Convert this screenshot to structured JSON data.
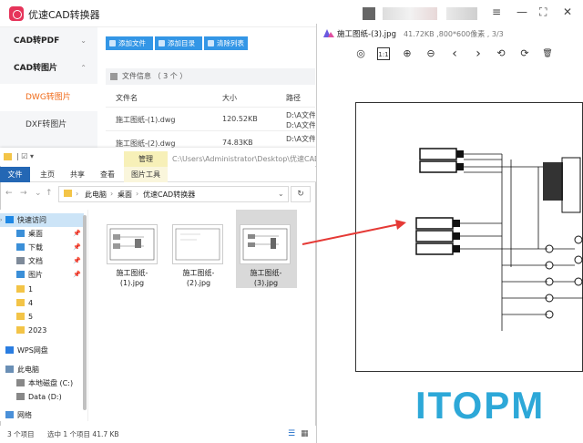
{
  "cad_app": {
    "title": "优速CAD转换器",
    "window_controls": [
      "≡",
      "—",
      "⛶",
      "✕"
    ],
    "sidebar": [
      {
        "label": "CAD转PDF",
        "chevron": "⌄"
      },
      {
        "label": "CAD转图片",
        "chevron": "⌃"
      },
      {
        "label": "DWG转图片",
        "active": true
      },
      {
        "label": "DXF转图片"
      }
    ],
    "toolbar": {
      "add_file": "添加文件",
      "add_folder": "添加目录",
      "clear_list": "清除列表"
    },
    "file_info": "文件信息 （ 3 个 ）",
    "columns": [
      "文件名",
      "大小",
      "路径"
    ],
    "rows": [
      {
        "name": "施工图纸-(1).dwg",
        "size": "120.52KB",
        "path1": "D:\\A文件夹",
        "path2": "D:\\A文件\\1.dwg"
      },
      {
        "name": "施工图纸-(2).dwg",
        "size": "74.83KB",
        "path1": "D:\\A文件夹",
        "path2": "D:\\A文件\\2.dwg"
      }
    ]
  },
  "explorer": {
    "manage_tab": "管理",
    "title_path": "C:\\Users\\Administrator\\Desktop\\优速CAD",
    "ribbon_tabs": [
      "文件",
      "主页",
      "共享",
      "查看",
      "图片工具"
    ],
    "breadcrumb": [
      "此电脑",
      "桌面",
      "优速CAD转换器"
    ],
    "nav_items": [
      {
        "label": "快速访问",
        "selected": true
      },
      {
        "label": "桌面",
        "pinned": true
      },
      {
        "label": "下载",
        "pinned": true
      },
      {
        "label": "文档",
        "pinned": true
      },
      {
        "label": "图片",
        "pinned": true
      },
      {
        "label": "1"
      },
      {
        "label": "4"
      },
      {
        "label": "5"
      },
      {
        "label": "2023"
      },
      {
        "label": "WPS网盘"
      },
      {
        "label": "此电脑"
      },
      {
        "label": "本地磁盘 (C:)"
      },
      {
        "label": "Data (D:)"
      },
      {
        "label": "网络"
      }
    ],
    "files": [
      {
        "line1": "施工图纸-",
        "line2": "(1).jpg"
      },
      {
        "line1": "施工图纸-",
        "line2": "(2).jpg"
      },
      {
        "line1": "施工图纸-",
        "line2": "(3).jpg",
        "selected": true
      }
    ],
    "status": {
      "count": "3 个项目",
      "selected": "选中 1 个项目  41.7 KB"
    }
  },
  "viewer": {
    "title": "施工图纸-(3).jpg",
    "meta": "41.72KB ,800*600像素 , 3/3",
    "tools": [
      "mouse-icon",
      "actual-size-icon",
      "zoom-in-icon",
      "zoom-out-icon",
      "prev-icon",
      "next-icon",
      "rotate-left-icon",
      "rotate-right-icon",
      "delete-icon"
    ],
    "tool_glyphs": [
      "◎",
      "1:1",
      "⊕",
      "⊖",
      "‹",
      "›",
      "⟲",
      "⟳",
      "🗑"
    ]
  },
  "watermark": "ITOPM",
  "colors": {
    "accent_orange": "#f06a18",
    "toolbar_blue": "#3396e6",
    "explorer_file_tab": "#2467b4",
    "arrow_red": "#e53935",
    "watermark": "#2da8d8"
  }
}
